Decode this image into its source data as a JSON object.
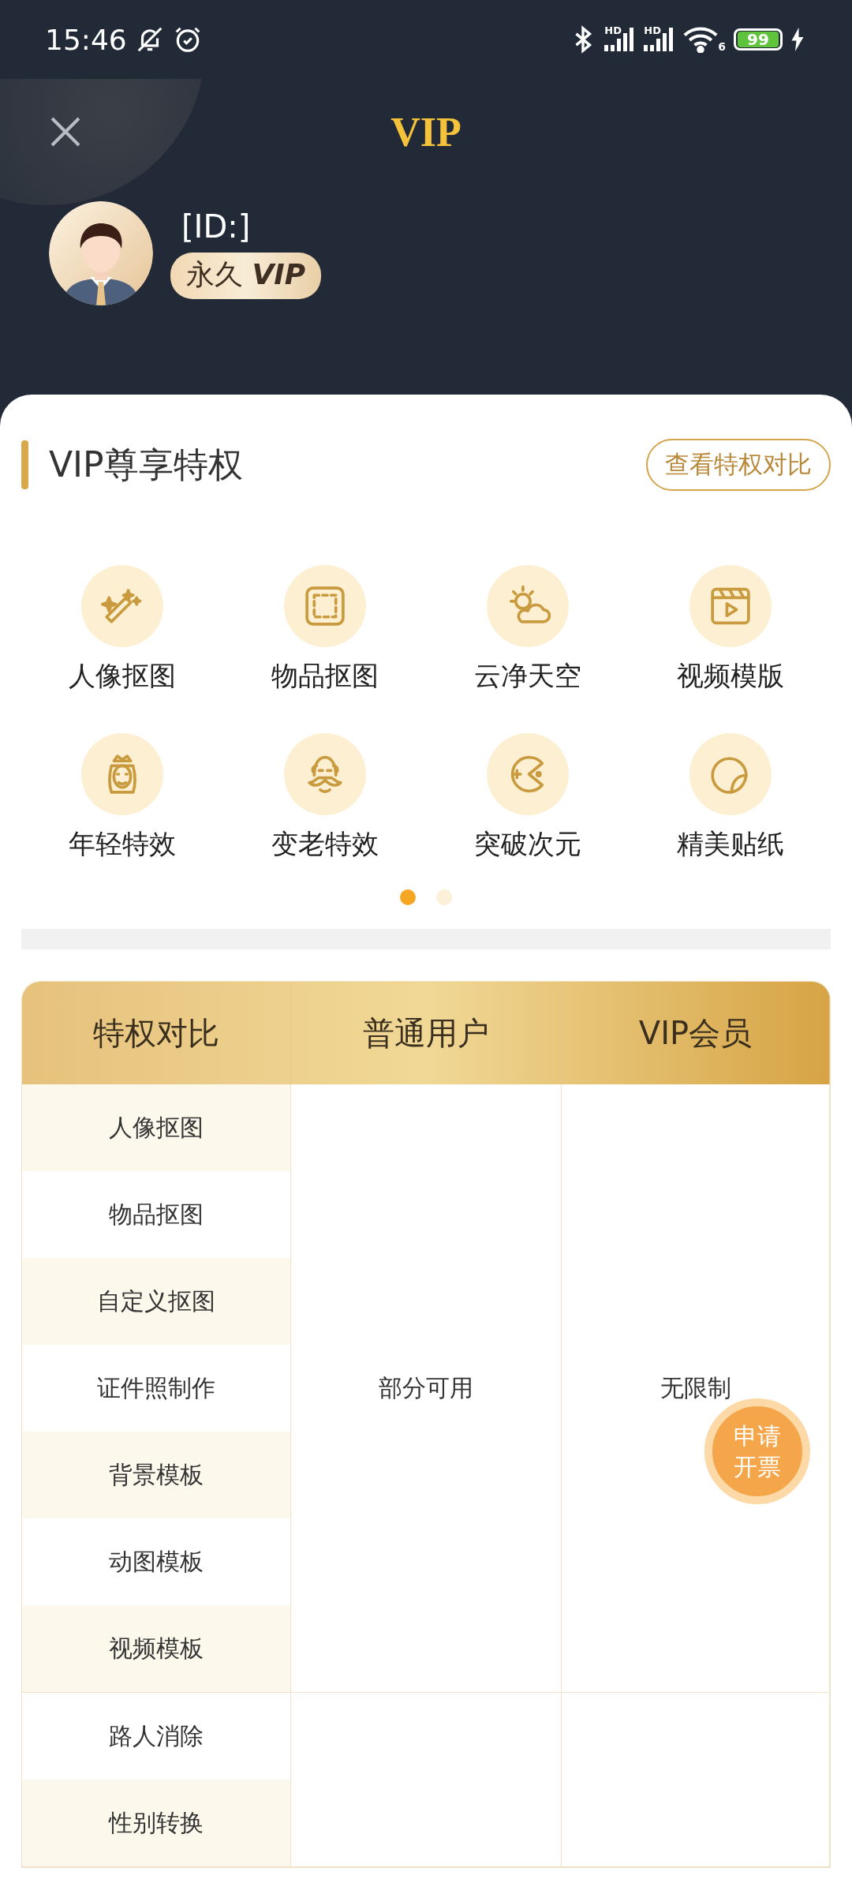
{
  "status_bar": {
    "time": "15:46",
    "signal_labels": [
      "HD",
      "HD"
    ],
    "wifi_label": "6",
    "battery": "99"
  },
  "header": {
    "title": "VIP",
    "user_id": "[ID:]",
    "badge": "永久 **VIP**"
  },
  "privileges": {
    "title": "VIP尊享特权",
    "compare_button": "查看特权对比",
    "items": [
      {
        "label": "人像抠图"
      },
      {
        "label": "物品抠图"
      },
      {
        "label": "云净天空"
      },
      {
        "label": "视频模版"
      },
      {
        "label": "年轻特效"
      },
      {
        "label": "变老特效"
      },
      {
        "label": "突破次元"
      },
      {
        "label": "精美贴纸"
      }
    ],
    "pages": [
      {
        "selected": true
      },
      {
        "selected": false
      }
    ]
  },
  "table": {
    "columns": [
      "特权对比",
      "普通用户",
      "VIP会员"
    ],
    "groups": [
      {
        "features": [
          "人像抠图",
          "物品抠图",
          "自定义抠图",
          "证件照制作",
          "背景模板",
          "动图模板",
          "视频模板"
        ],
        "normal": "部分可用",
        "vip": "无限制"
      },
      {
        "features": [
          "路人消除",
          "性别转换"
        ]
      }
    ]
  },
  "invoice_button": "申请开票"
}
